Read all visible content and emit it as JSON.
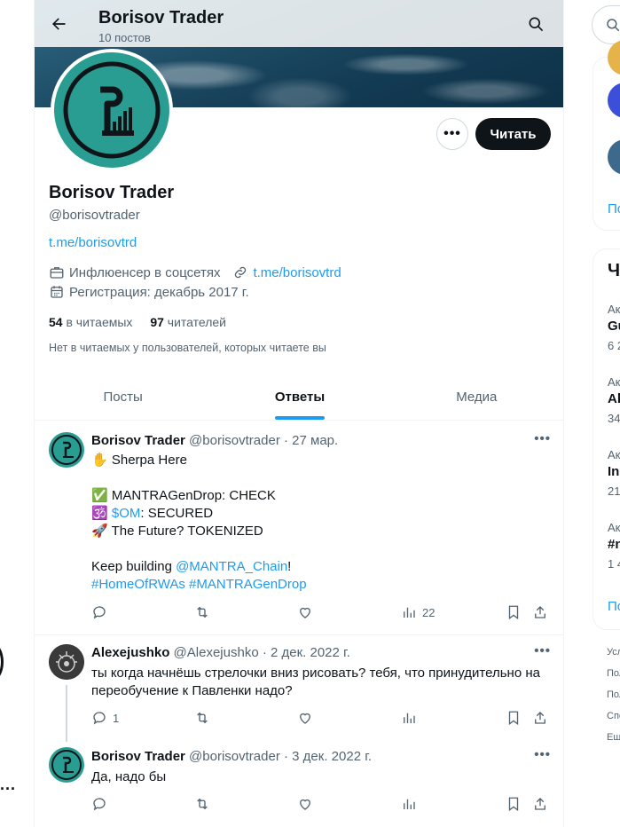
{
  "header": {
    "title": "Borisov Trader",
    "subtitle": "10 постов"
  },
  "profile": {
    "name": "Borisov Trader",
    "handle": "@borisovtrader",
    "bio_link": "t.me/borisovtrd",
    "category": "Инфлюенсер в соцсетях",
    "website": "t.me/borisovtrd",
    "joined": "Регистрация: декабрь 2017 г.",
    "following_count": "54",
    "following_label": "в читаемых",
    "followers_count": "97",
    "followers_label": "читателей",
    "mutuals_note": "Нет в читаемых у пользователей, которых читаете вы",
    "follow_label": "Читать",
    "more_label": "•••"
  },
  "tabs": [
    {
      "label": "Посты",
      "active": false
    },
    {
      "label": "Ответы",
      "active": true
    },
    {
      "label": "Медиа",
      "active": false
    }
  ],
  "tweets": [
    {
      "name": "Borisov Trader",
      "handle": "@borisovtrader",
      "date": "· 27 мар.",
      "line1_emoji": "✋",
      "line1": "Sherpa Here",
      "line2_emoji": "✅",
      "line2": "MANTRAGenDrop: CHECK",
      "line3_emoji": "🕉️",
      "line3_link": "$OM",
      "line3": ": SECURED",
      "line4_emoji": "🚀",
      "line4": "The Future? TOKENIZED",
      "line5": "Keep building ",
      "line5_link": "@MANTRA_Chain",
      "line5_end": "!",
      "line6_tag1": "#HomeOfRWAs",
      "line6_tag2": "#MANTRAGenDrop",
      "views": "22"
    },
    {
      "name": "Alexejushko",
      "handle": "@Alexejushko",
      "date": "· 2 дек. 2022 г.",
      "text": "ты когда начнёшь стрелочки вниз рисовать? тебя, что принудительно на переобучение к Павленки надо?",
      "replies": "1"
    },
    {
      "name": "Borisov Trader",
      "handle": "@borisovtrader",
      "date": "· 3 дек. 2022 г.",
      "text": "Да, надо бы"
    }
  ],
  "right": {
    "card1_link": "По",
    "card2_title": "Чи",
    "trends": [
      {
        "top": "Ак",
        "mid": "Gu",
        "bot": "6 2"
      },
      {
        "top": "Ак",
        "mid": "Ab",
        "bot": "34"
      },
      {
        "top": "Ак",
        "mid": "In",
        "bot": "21,"
      },
      {
        "top": "Ак",
        "mid": "#n",
        "bot": "1 4"
      }
    ],
    "card2_link": "По",
    "footer": [
      "Усл",
      "Пол",
      "Пол",
      "Спе",
      "Ещ"
    ]
  },
  "left_fragment": "..."
}
